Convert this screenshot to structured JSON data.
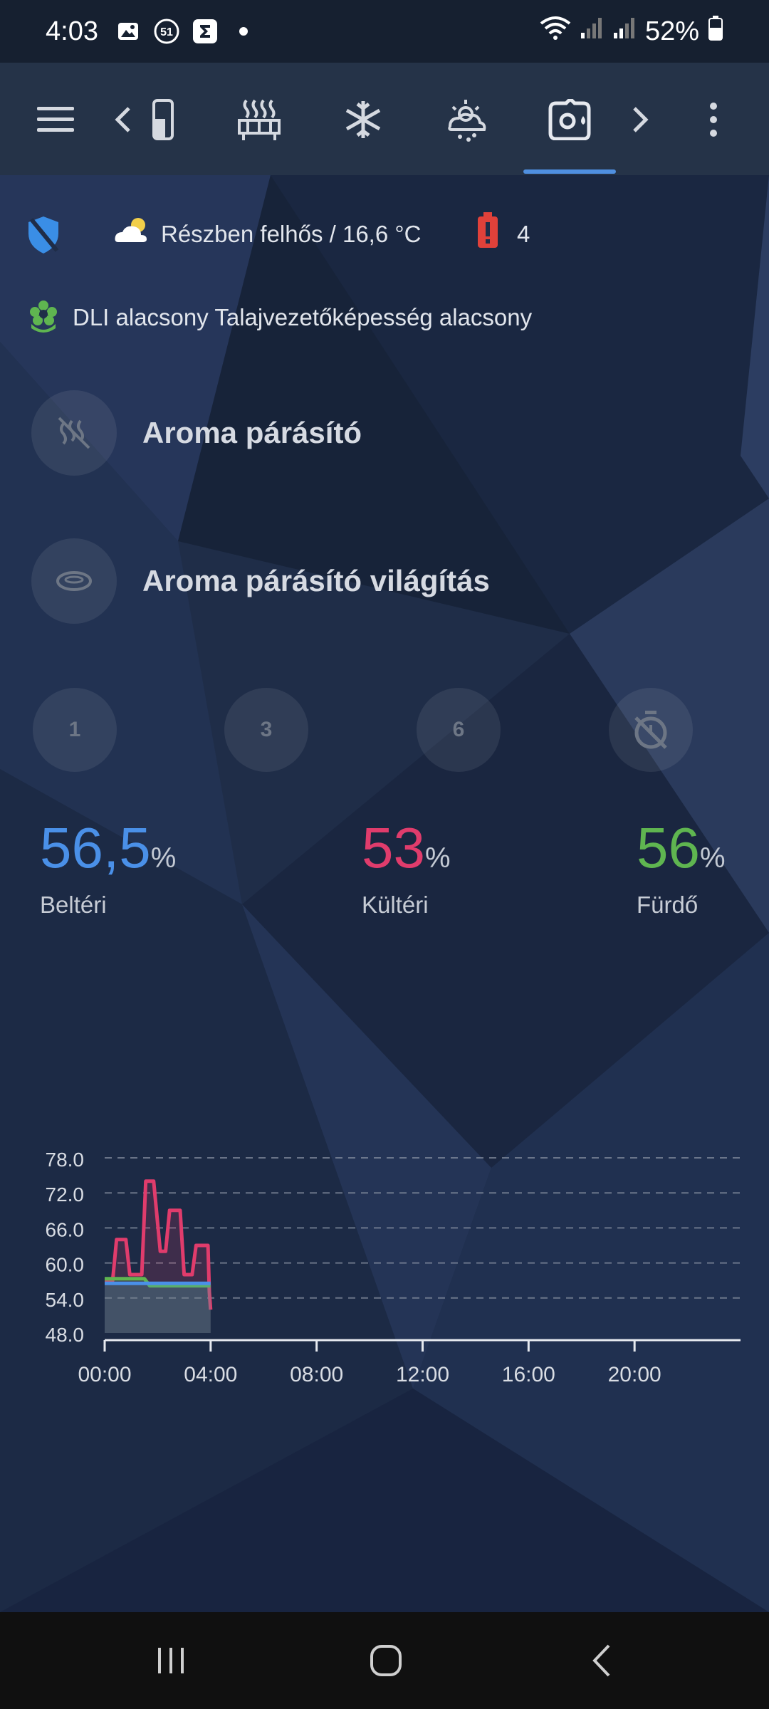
{
  "status_bar": {
    "time": "4:03",
    "notification_badge": "51",
    "battery": "52%"
  },
  "toolbar": {
    "icons": [
      "menu-icon",
      "prev-icon",
      "device-icon",
      "heater-icon",
      "snowflake-icon",
      "weather-icon",
      "humidifier-icon",
      "next-icon",
      "more-icon"
    ],
    "active_tab": "humidifier-icon"
  },
  "info": {
    "weather": "Részben felhős / 16,6 °C",
    "battery_alert_count": "4"
  },
  "alert": {
    "text": "DLI alacsony Talajvezetőképesség alacsony"
  },
  "entities": [
    {
      "name": "Aroma párásító"
    },
    {
      "name": "Aroma párásító világítás"
    }
  ],
  "timer_buttons": [
    "1",
    "3",
    "6"
  ],
  "sensors": [
    {
      "value": "56,5",
      "unit": "%",
      "label": "Beltéri",
      "color": "#4a90e8"
    },
    {
      "value": "53",
      "unit": "%",
      "label": "Kültéri",
      "color": "#e03c6c"
    },
    {
      "value": "56",
      "unit": "%",
      "label": "Fürdő",
      "color": "#5fb550"
    }
  ],
  "chart_data": {
    "type": "line",
    "y_ticks": [
      "78.0",
      "72.0",
      "66.0",
      "60.0",
      "54.0",
      "48.0"
    ],
    "x_ticks": [
      "00:00",
      "04:00",
      "08:00",
      "12:00",
      "16:00",
      "20:00"
    ],
    "ylim": [
      48,
      78
    ],
    "xlim": [
      0,
      24
    ],
    "grid": true,
    "series": [
      {
        "color": "#e03c6c",
        "x": [
          0,
          0.3,
          0.45,
          0.8,
          0.95,
          1.4,
          1.55,
          1.85,
          2.1,
          2.3,
          2.45,
          2.85,
          3.0,
          3.3,
          3.45,
          3.9,
          3.95,
          4.0
        ],
        "y": [
          57,
          57,
          64,
          64,
          58,
          58,
          74,
          74,
          62,
          62,
          69,
          69,
          58,
          58,
          63,
          63,
          55,
          52
        ]
      },
      {
        "color": "#5fb550",
        "x": [
          0,
          1.5,
          1.7,
          4.0
        ],
        "y": [
          57.3,
          57.3,
          56.1,
          56.1
        ]
      },
      {
        "color": "#4a90e8",
        "x": [
          0,
          4.0
        ],
        "y": [
          56.5,
          56.5
        ]
      }
    ]
  }
}
